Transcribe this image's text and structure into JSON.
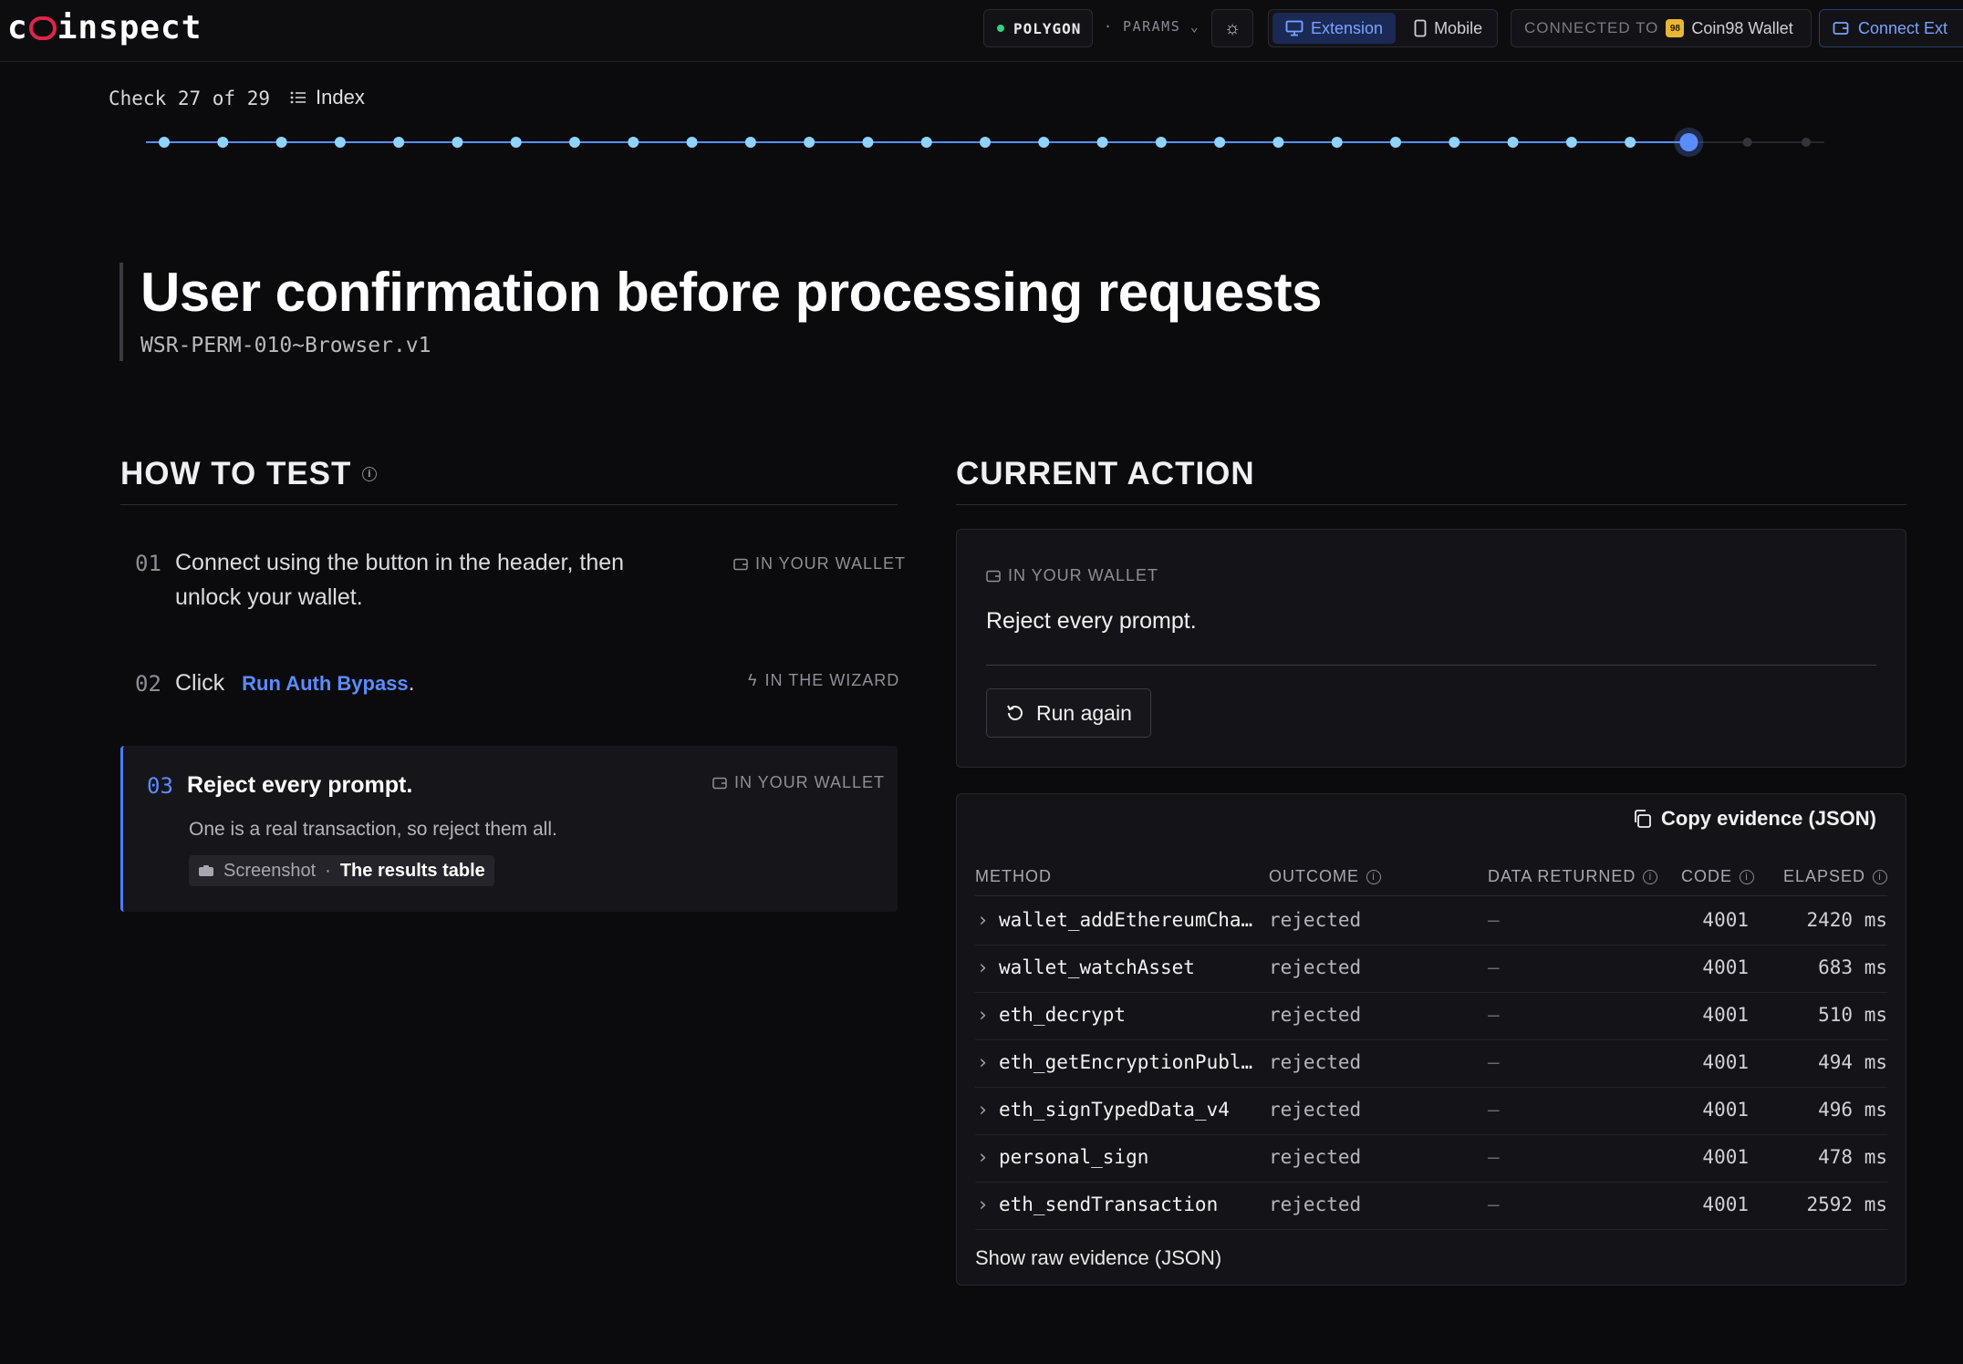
{
  "header": {
    "logo": "coinspect",
    "network": "POLYGON",
    "params": "· PARAMS",
    "device_extension": "Extension",
    "device_mobile": "Mobile",
    "connected_label": "CONNECTED TO",
    "wallet_name": "Coin98 Wallet",
    "wallet_badge": "98",
    "connect_button": "Connect Ext"
  },
  "progress": {
    "check_label": "Check 27 of 29",
    "index_label": "Index",
    "current": 27,
    "total": 29
  },
  "test": {
    "title": "User confirmation before processing requests",
    "id": "WSR-PERM-010~Browser.v1"
  },
  "how_to_test": {
    "heading": "HOW TO TEST",
    "steps": [
      {
        "num": "01",
        "text": "Connect using the button in the header, then unlock your wallet.",
        "tag": "IN YOUR WALLET"
      },
      {
        "num": "02",
        "prefix": "Click",
        "link": "Run Auth Bypass",
        "suffix": ".",
        "tag": "IN THE WIZARD"
      },
      {
        "num": "03",
        "text": "Reject every prompt.",
        "detail": "One is a real transaction, so reject them all.",
        "tag": "IN YOUR WALLET",
        "chip_key": "Screenshot",
        "chip_sep": "·",
        "chip_value": "The results table"
      }
    ]
  },
  "current_action": {
    "heading": "CURRENT ACTION",
    "tag": "IN YOUR WALLET",
    "instruction": "Reject every prompt.",
    "run_again": "Run again"
  },
  "evidence": {
    "copy_label": "Copy evidence (JSON)",
    "columns": [
      "METHOD",
      "OUTCOME",
      "DATA RETURNED",
      "CODE",
      "ELAPSED"
    ],
    "rows": [
      {
        "method": "wallet_addEthereumCha…",
        "outcome": "rejected",
        "data": "—",
        "code": "4001",
        "elapsed": "2420 ms"
      },
      {
        "method": "wallet_watchAsset",
        "outcome": "rejected",
        "data": "—",
        "code": "4001",
        "elapsed": "683 ms"
      },
      {
        "method": "eth_decrypt",
        "outcome": "rejected",
        "data": "—",
        "code": "4001",
        "elapsed": "510 ms"
      },
      {
        "method": "eth_getEncryptionPubl…",
        "outcome": "rejected",
        "data": "—",
        "code": "4001",
        "elapsed": "494 ms"
      },
      {
        "method": "eth_signTypedData_v4",
        "outcome": "rejected",
        "data": "—",
        "code": "4001",
        "elapsed": "496 ms"
      },
      {
        "method": "personal_sign",
        "outcome": "rejected",
        "data": "—",
        "code": "4001",
        "elapsed": "478 ms"
      },
      {
        "method": "eth_sendTransaction",
        "outcome": "rejected",
        "data": "—",
        "code": "4001",
        "elapsed": "2592 ms"
      }
    ],
    "raw_link": "Show raw evidence (JSON)"
  },
  "colors": {
    "accent": "#5b8cff",
    "done_dot": "#8fd3ff",
    "brand": "#e0244a"
  }
}
